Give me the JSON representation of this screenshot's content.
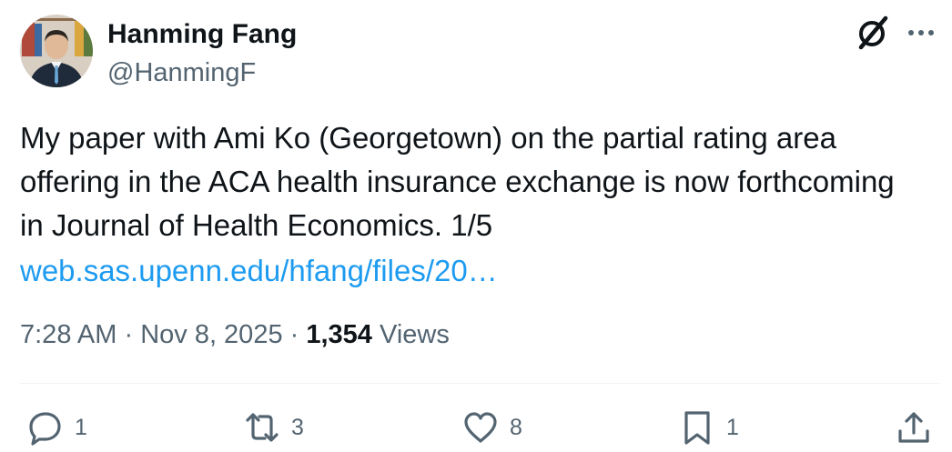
{
  "author": {
    "display_name": "Hanming Fang",
    "handle": "@HanmingF"
  },
  "icons": {
    "avatar": "avatar-photo",
    "grok": "grok-icon",
    "more": "more-horizontal-icon",
    "reply": "reply-icon",
    "repost": "repost-icon",
    "like": "heart-icon",
    "bookmark": "bookmark-icon",
    "share": "share-icon"
  },
  "tweet": {
    "text": "My paper with Ami Ko (Georgetown) on the partial rating area\noffering in the ACA health insurance exchange is now forthcoming\nin Journal of Health Economics.  1/5",
    "link": "web.sas.upenn.edu/hfang/files/20…"
  },
  "meta": {
    "time": "7:28 AM",
    "separator": " · ",
    "date": "Nov 8, 2025",
    "views_count": "1,354",
    "views_label": " Views"
  },
  "actions": {
    "reply_count": "1",
    "repost_count": "3",
    "like_count": "8",
    "bookmark_count": "1"
  },
  "colors": {
    "text": "#0f1419",
    "secondary": "#536471",
    "link": "#1d9bf0",
    "divider": "#eff3f4"
  }
}
